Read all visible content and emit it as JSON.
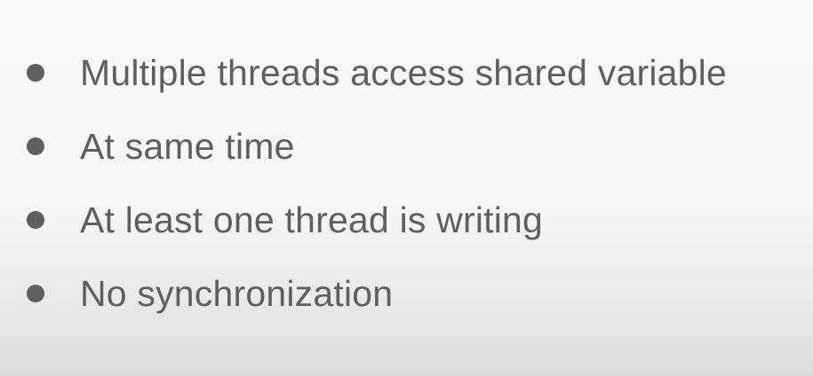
{
  "slide": {
    "bullets": [
      {
        "text": "Multiple threads access shared variable"
      },
      {
        "text": "At same time"
      },
      {
        "text": "At least one thread is writing"
      },
      {
        "text": "No synchronization"
      }
    ]
  },
  "colors": {
    "text": "#5f5f5f",
    "background": "#f7f7f7"
  }
}
